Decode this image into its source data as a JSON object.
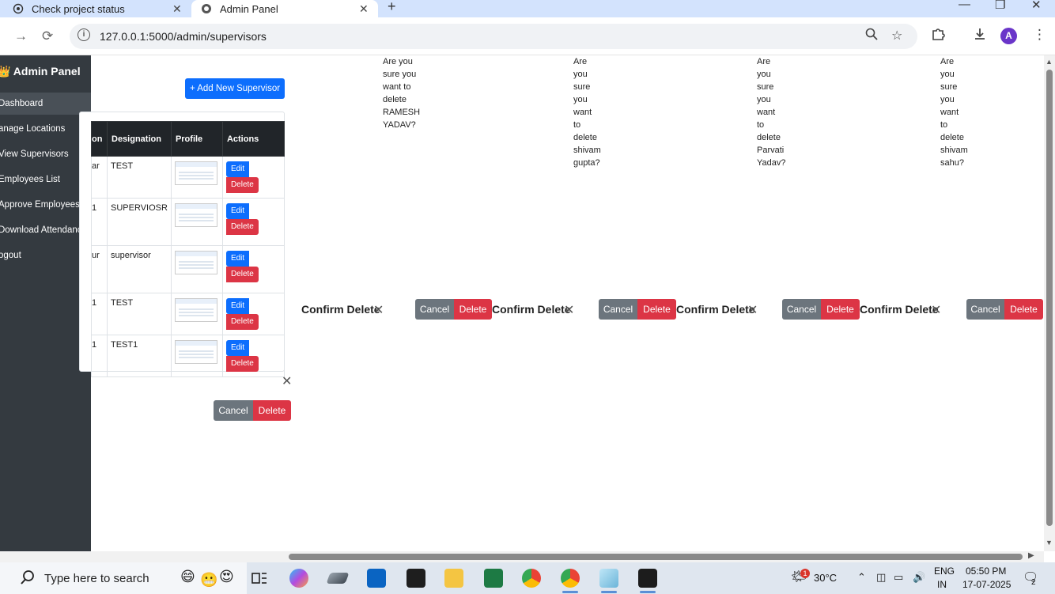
{
  "browser": {
    "tabs": [
      {
        "title": "Check project status"
      },
      {
        "title": "Admin Panel"
      }
    ],
    "url": "127.0.0.1:5000/admin/supervisors",
    "profile_initial": "A"
  },
  "sidebar": {
    "title": "👑 Admin Panel",
    "items": [
      {
        "label": "Dashboard"
      },
      {
        "label": "anage Locations"
      },
      {
        "label": "View Supervisors"
      },
      {
        "label": "Employees List"
      },
      {
        "label": "Approve Employees"
      },
      {
        "label": "Download Attendance"
      },
      {
        "label": "ogout"
      }
    ]
  },
  "main": {
    "add_button": "+ Add New Supervisor",
    "table": {
      "headers": [
        "on",
        "Designation",
        "Profile",
        "Actions"
      ],
      "rows": [
        {
          "location": "ar",
          "designation": "TEST"
        },
        {
          "location": "1",
          "designation": "SUPERVIOSR"
        },
        {
          "location": "ur",
          "designation": "supervisor"
        },
        {
          "location": "1",
          "designation": "TEST"
        },
        {
          "location": "1",
          "designation": "TEST1"
        }
      ],
      "edit_label": "Edit",
      "delete_label": "Delete"
    }
  },
  "modals": {
    "cancel_label": "Cancel",
    "delete_label": "Delete",
    "title": "Confirm Delete",
    "bodies": [
      [
        "Are you",
        "sure you",
        "want to",
        "delete",
        "RAMESH",
        "YADAV?"
      ],
      [
        "Are",
        "you",
        "sure",
        "you",
        "want",
        "to",
        "delete",
        "shivam",
        "gupta?"
      ],
      [
        "Are",
        "you",
        "sure",
        "you",
        "want",
        "to",
        "delete",
        "Parvati",
        "Yadav?"
      ],
      [
        "Are",
        "you",
        "sure",
        "you",
        "want",
        "to",
        "delete",
        "shivam",
        "sahu?"
      ]
    ]
  },
  "taskbar": {
    "search_placeholder": "Type here to search",
    "weather_badge": "1",
    "temperature": "30°C",
    "lang_top": "ENG",
    "lang_bottom": "IN",
    "time": "05:50 PM",
    "date": "17-07-2025",
    "notification_count": "2"
  }
}
